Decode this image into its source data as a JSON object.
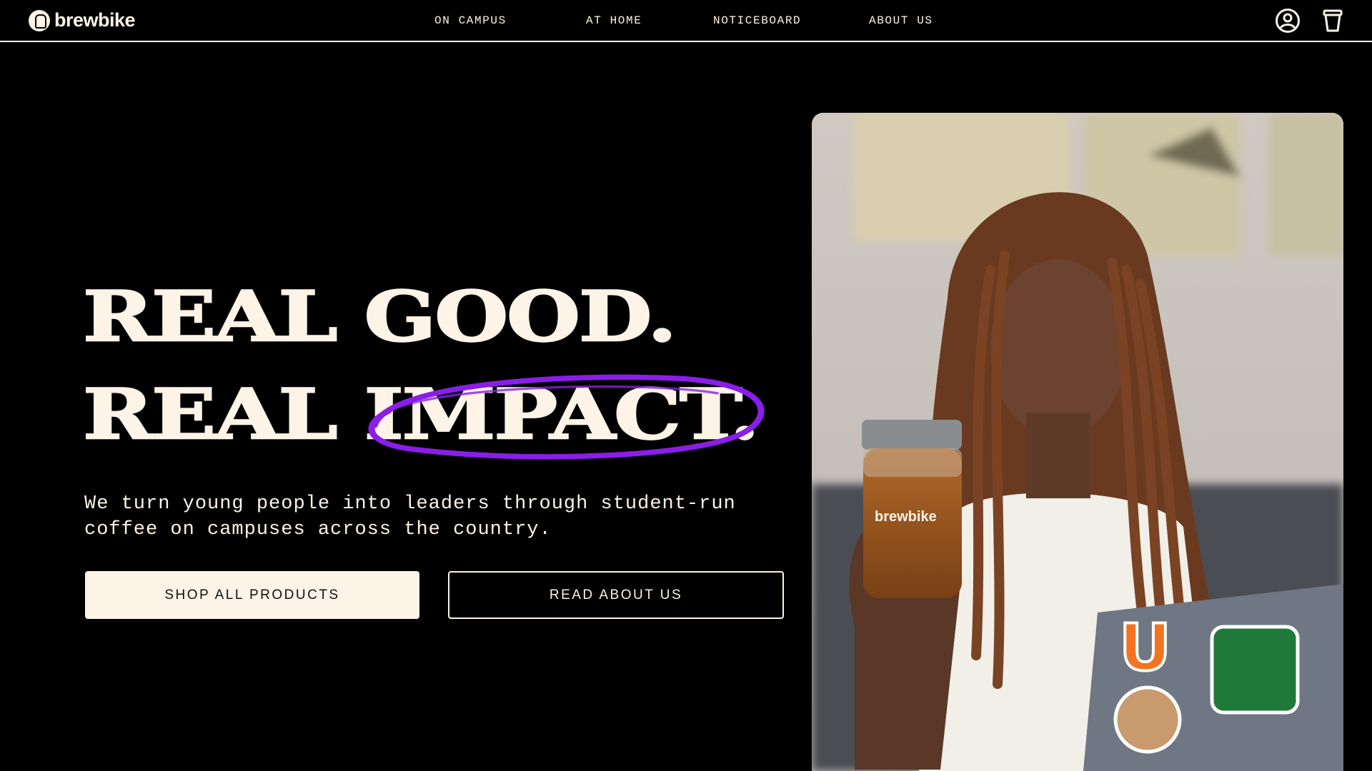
{
  "brand": {
    "name": "brewbike"
  },
  "nav": {
    "on_campus": "ON CAMPUS",
    "at_home": "AT HOME",
    "noticeboard": "NOTICEBOARD",
    "about_us": "ABOUT US"
  },
  "header_icons": [
    "account-icon",
    "cup-cart-icon"
  ],
  "hero": {
    "line1": "REAL GOOD.",
    "line2_prefix": "REAL ",
    "line2_highlight": "IMPACT.",
    "subtitle": "We turn young people into leaders through student-run coffee on campuses across the country.",
    "primary_button": "SHOP ALL PRODUCTS",
    "secondary_button": "READ ABOUT US"
  },
  "photo": {
    "jar_label": "brewbike",
    "laptop_sticker_letter": "U"
  },
  "colors": {
    "background": "#000000",
    "cream": "#fdf3e7",
    "accent_purple": "#8a1ee8"
  }
}
